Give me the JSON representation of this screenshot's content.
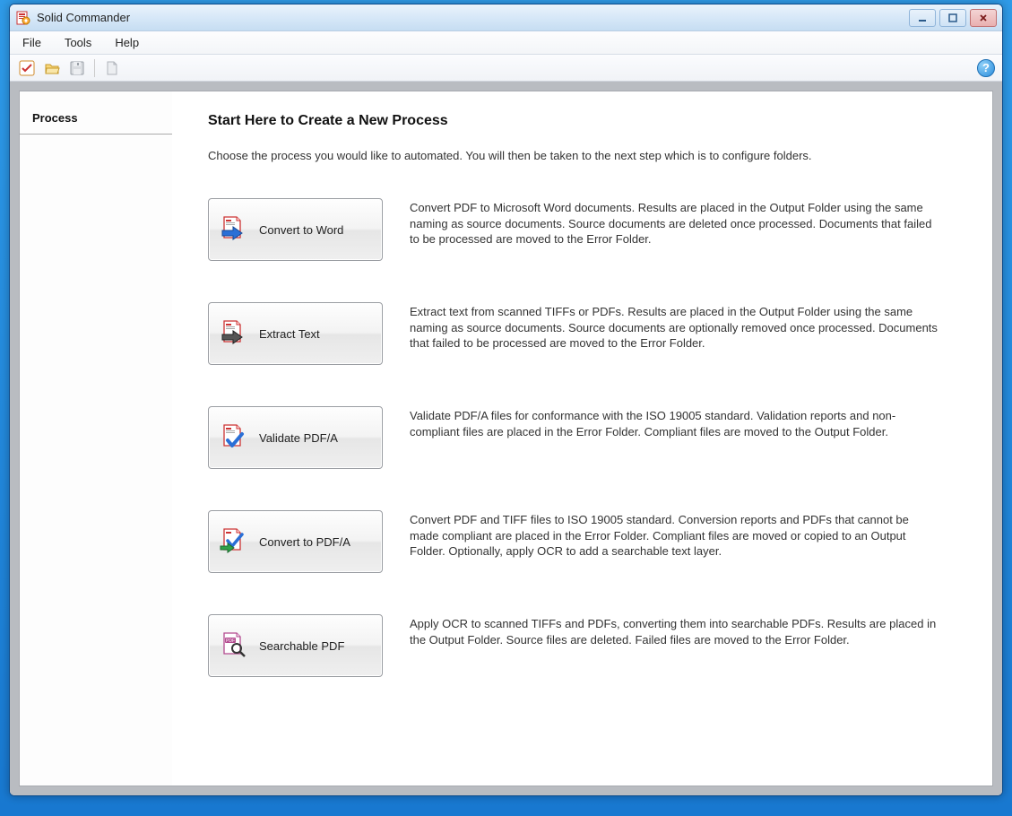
{
  "titlebar": {
    "title": "Solid Commander"
  },
  "menu": {
    "file": "File",
    "tools": "Tools",
    "help": "Help"
  },
  "toolbar": {
    "help_glyph": "?"
  },
  "sidebar": {
    "process": "Process"
  },
  "main": {
    "heading": "Start Here to Create a New Process",
    "subtitle": "Choose the process you would like to automated. You will then be taken to the next step which is to configure folders.",
    "processes": [
      {
        "label": "Convert to Word",
        "description": "Convert PDF to Microsoft Word documents. Results are placed in the Output Folder using the same naming as source documents. Source documents are deleted once processed. Documents that failed to be processed are moved to the Error Folder."
      },
      {
        "label": "Extract Text",
        "description": "Extract text from scanned TIFFs or PDFs. Results are placed in the Output Folder using the same naming as source documents. Source documents are optionally removed once processed. Documents that failed to be processed are moved to the Error Folder."
      },
      {
        "label": "Validate PDF/A",
        "description": "Validate PDF/A files for conformance with the ISO 19005 standard. Validation reports and non-compliant files are placed in the Error Folder. Compliant files are moved to the Output Folder."
      },
      {
        "label": "Convert to PDF/A",
        "description": "Convert PDF and TIFF files to ISO 19005 standard. Conversion reports and PDFs that cannot be made compliant are placed in the Error Folder. Compliant files are moved or copied to an Output Folder. Optionally, apply OCR to add a searchable text layer."
      },
      {
        "label": "Searchable PDF",
        "description": "Apply OCR to scanned TIFFs and PDFs, converting them into searchable PDFs. Results are placed in the Output Folder. Source files are deleted. Failed files are moved to the Error Folder."
      }
    ]
  }
}
